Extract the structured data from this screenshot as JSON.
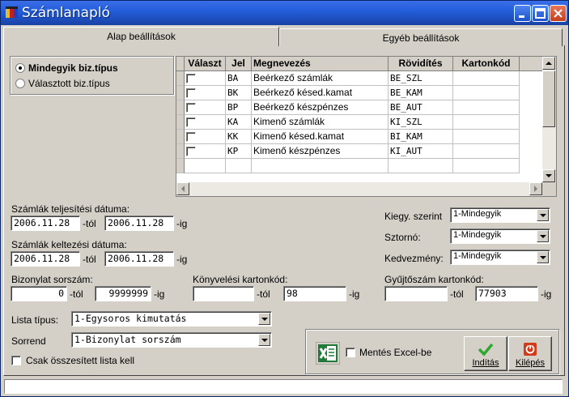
{
  "window": {
    "title": "Számlanapló"
  },
  "tabs": [
    {
      "label": "Alap beállítások"
    },
    {
      "label": "Egyéb beállítások"
    }
  ],
  "type_selection": {
    "options": [
      {
        "label": "Mindegyik biz.típus",
        "selected": true
      },
      {
        "label": "Választott biz.típus",
        "selected": false
      }
    ]
  },
  "grid": {
    "columns": [
      "Választ",
      "Jel",
      "Megnevezés",
      "Rövidítés",
      "Kartonkód"
    ],
    "rows": [
      {
        "jel": "BA",
        "name": "Beérkező számlák",
        "abbr": "BE_SZL",
        "karton": ""
      },
      {
        "jel": "BK",
        "name": "Beérkező késed.kamat",
        "abbr": "BE_KAM",
        "karton": ""
      },
      {
        "jel": "BP",
        "name": "Beérkező készpénzes",
        "abbr": "BE_AUT",
        "karton": ""
      },
      {
        "jel": "KA",
        "name": "Kimenő számlák",
        "abbr": "KI_SZL",
        "karton": ""
      },
      {
        "jel": "KK",
        "name": "Kimenő késed.kamat",
        "abbr": "BI_KAM",
        "karton": ""
      },
      {
        "jel": "KP",
        "name": "Kimenő készpénzes",
        "abbr": "KI_AUT",
        "karton": ""
      }
    ]
  },
  "dates": {
    "teljesitesi_label": "Számlák teljesítési dátuma:",
    "teljesitesi_from": "2006.11.28",
    "teljesitesi_to": "2006.11.28",
    "keltezesi_label": "Számlák keltezési dátuma:",
    "keltezesi_from": "2006.11.28",
    "keltezesi_to": "2006.11.28",
    "from_suffix": "-tól",
    "to_suffix": "-ig"
  },
  "filters": {
    "kieg_label": "Kiegy. szerint",
    "kieg_value": "1-Mindegyik",
    "sztorno_label": "Sztornó:",
    "sztorno_value": "1-Mindegyik",
    "kedvezmeny_label": "Kedvezmény:",
    "kedvezmeny_value": "1-Mindegyik"
  },
  "ranges": {
    "bizonylat_label": "Bizonylat sorszám:",
    "bizonylat_from": "0",
    "bizonylat_to": "9999999",
    "konyvelesi_label": "Könyvelési kartonkód:",
    "konyvelesi_from": "",
    "konyvelesi_to": "98",
    "gyujto_label": "Gyűjtőszám kartonkód:",
    "gyujto_from": "",
    "gyujto_to": "77903"
  },
  "list": {
    "tipus_label": "Lista típus:",
    "tipus_value": "1-Egysoros kimutatás",
    "sorrend_label": "Sorrend",
    "sorrend_value": "1-Bizonylat sorszám",
    "only_summary_label": "Csak összesített lista kell"
  },
  "actions": {
    "excel_label": "Mentés Excel-be",
    "start_label": "Indítás",
    "exit_label": "Kilépés"
  },
  "colors": {
    "title_bar": "#245edb",
    "face": "#d4d0c8",
    "excel_green": "#1f7a3a",
    "start_check": "#2ea82e",
    "exit_red": "#d23a1a"
  }
}
